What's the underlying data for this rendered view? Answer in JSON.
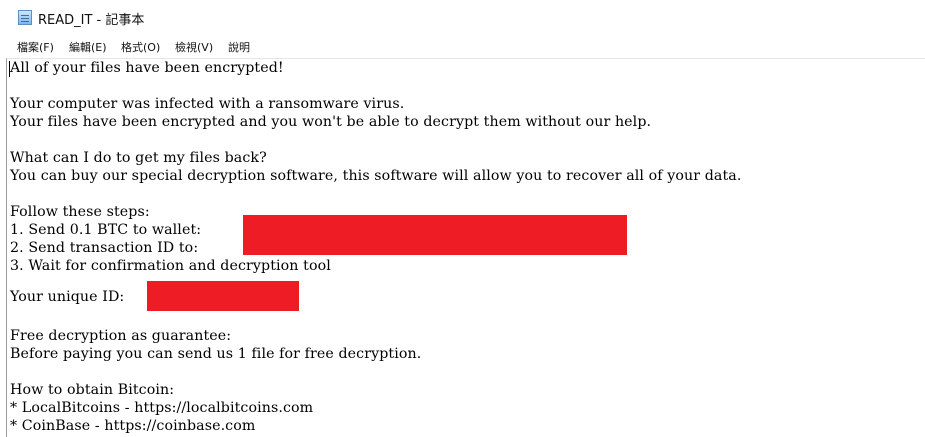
{
  "window": {
    "title": "READ_IT - 記事本"
  },
  "menu": {
    "file": "檔案(F)",
    "edit": "編輯(E)",
    "format": "格式(O)",
    "view": "檢視(V)",
    "help": "說明"
  },
  "icons": {
    "app": "notepad-icon"
  },
  "colors": {
    "redaction": "#ee1c25"
  },
  "document": {
    "lines": [
      "All of your files have been encrypted!",
      "",
      "Your computer was infected with a ransomware virus.",
      "Your files have been encrypted and you won't be able to decrypt them without our help.",
      "",
      "What can I do to get my files back?",
      "You can buy our special decryption software, this software will allow you to recover all of your data.",
      "",
      "Follow these steps:",
      "1. Send 0.1 BTC to wallet:",
      "2. Send transaction ID to:",
      "3. Wait for confirmation and decryption tool",
      "",
      "Your unique ID:",
      "",
      "Free decryption as guarantee:",
      "Before paying you can send us 1 file for free decryption.",
      "",
      "How to obtain Bitcoin:",
      "* LocalBitcoins - https://localbitcoins.com",
      "* CoinBase - https://coinbase.com"
    ]
  }
}
